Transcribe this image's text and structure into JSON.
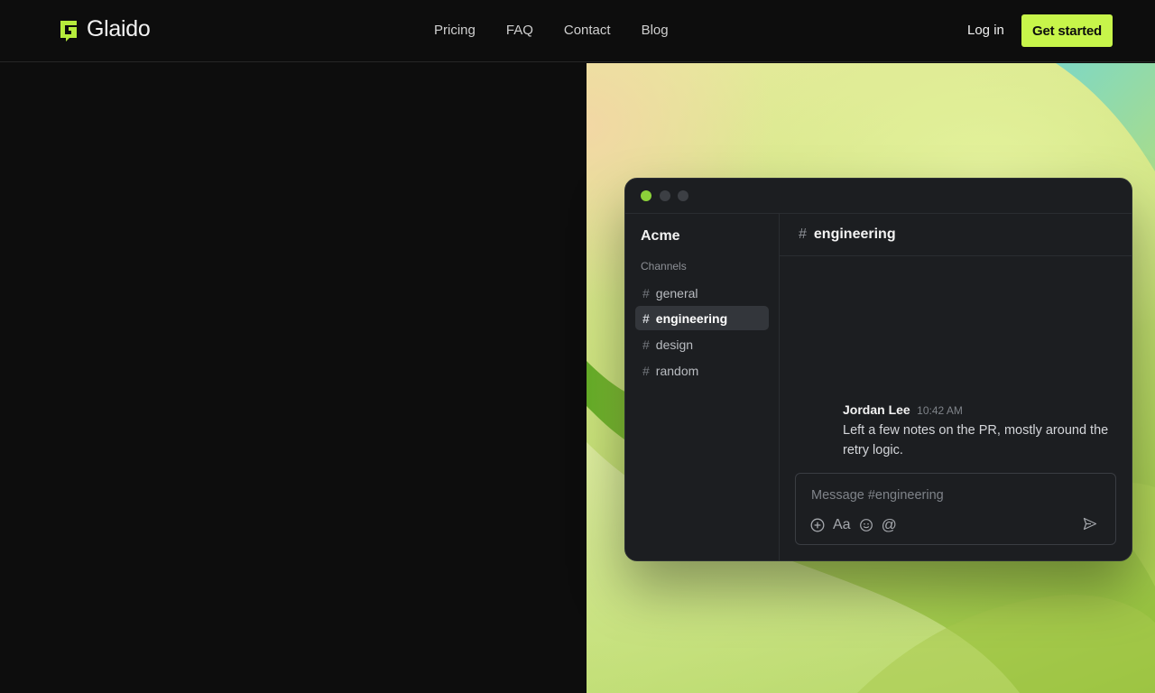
{
  "brand": {
    "name": "Glaido",
    "accent": "#c7f54a"
  },
  "nav": {
    "links": [
      {
        "label": "Pricing"
      },
      {
        "label": "FAQ"
      },
      {
        "label": "Contact"
      },
      {
        "label": "Blog"
      }
    ],
    "login_label": "Log in",
    "cta_label": "Get started"
  },
  "app": {
    "workspace": "Acme",
    "section_label": "Channels",
    "channels": [
      {
        "hash": "#",
        "name": "general",
        "active": false
      },
      {
        "hash": "#",
        "name": "engineering",
        "active": true
      },
      {
        "hash": "#",
        "name": "design",
        "active": false
      },
      {
        "hash": "#",
        "name": "random",
        "active": false
      }
    ],
    "current_channel": {
      "hash": "#",
      "name": "engineering"
    },
    "message": {
      "author": "Jordan Lee",
      "time": "10:42 AM",
      "text": "Left a few notes on the PR, mostly around the retry logic."
    },
    "composer": {
      "placeholder": "Message #engineering",
      "tools": [
        {
          "icon": "plus-circle-icon"
        },
        {
          "label": "Aa",
          "icon": "text-format-icon"
        },
        {
          "icon": "emoji-icon"
        },
        {
          "label": "@",
          "icon": "mention-icon"
        }
      ],
      "send_icon": "send-icon"
    },
    "window_dots": [
      "#8cd23a",
      "#3c3f44",
      "#3c3f44"
    ]
  }
}
